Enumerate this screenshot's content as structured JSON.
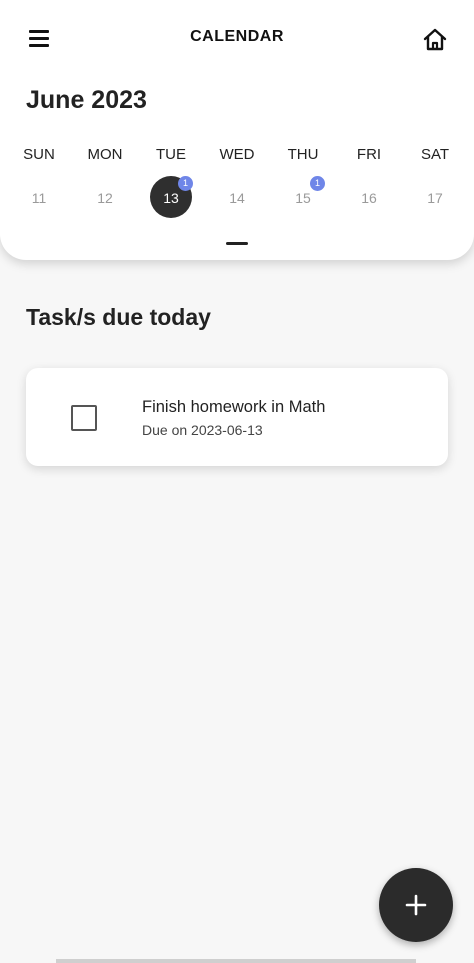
{
  "appbar": {
    "title": "CALENDAR",
    "menu_icon": "hamburger-menu-icon",
    "home_icon": "home-icon"
  },
  "calendar": {
    "month_title": "June 2023",
    "days": [
      {
        "name": "SUN",
        "num": "11",
        "badge": ""
      },
      {
        "name": "MON",
        "num": "12",
        "badge": ""
      },
      {
        "name": "TUE",
        "num": "13",
        "badge": "1",
        "selected": true
      },
      {
        "name": "WED",
        "num": "14",
        "badge": ""
      },
      {
        "name": "THU",
        "num": "15",
        "badge": "1"
      },
      {
        "name": "FRI",
        "num": "16",
        "badge": ""
      },
      {
        "name": "SAT",
        "num": "17",
        "badge": ""
      }
    ],
    "badge_color": "#6f86e8",
    "selected_color": "#2f2f2f"
  },
  "tasks": {
    "section_title": "Task/s due today",
    "items": [
      {
        "title": "Finish homework in Math",
        "due": "Due on 2023-06-13",
        "checked": false
      }
    ]
  },
  "fab": {
    "icon": "plus-icon",
    "color": "#2b2b2b"
  }
}
